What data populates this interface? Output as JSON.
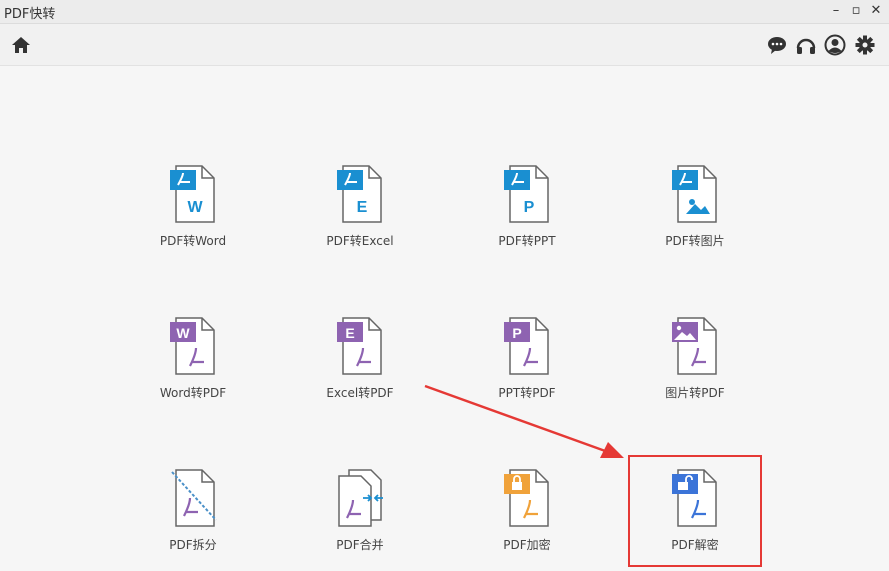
{
  "window": {
    "title": "PDF快转",
    "minimize_label": "–",
    "restore_label": "▫",
    "close_label": "✕"
  },
  "toolbar": {
    "home_icon": "home-icon",
    "right_icons": [
      "chat-icon",
      "headset-icon",
      "account-icon",
      "gear-icon"
    ]
  },
  "tools": {
    "row1": [
      {
        "label": "PDF转Word",
        "letter": "W"
      },
      {
        "label": "PDF转Excel",
        "letter": "E"
      },
      {
        "label": "PDF转PPT",
        "letter": "P"
      },
      {
        "label": "PDF转图片",
        "icon": "image-icon"
      }
    ],
    "row2": [
      {
        "label": "Word转PDF",
        "letter": "W"
      },
      {
        "label": "Excel转PDF",
        "letter": "E"
      },
      {
        "label": "PPT转PDF",
        "letter": "P"
      },
      {
        "label": "图片转PDF",
        "icon": "image-icon"
      }
    ],
    "row3": [
      {
        "label": "PDF拆分",
        "icon": "split-icon"
      },
      {
        "label": "PDF合并",
        "icon": "merge-icon"
      },
      {
        "label": "PDF加密",
        "icon": "lock-icon"
      },
      {
        "label": "PDF解密",
        "icon": "unlock-icon"
      }
    ]
  },
  "colors": {
    "pdf_blue": "#1a8fd1",
    "office_purple": "#8e63b1",
    "lock_orange": "#f0a23a",
    "unlock_blue": "#3b74d8",
    "annotation_red": "#e53935"
  }
}
